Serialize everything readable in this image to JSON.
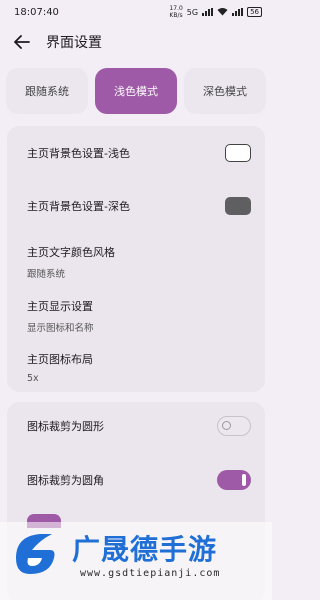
{
  "status_bar": {
    "time": "18:07:40",
    "net_speed_top": "17.0",
    "net_speed_unit": "KB/s",
    "network": "5G",
    "battery": "56"
  },
  "app_bar": {
    "title": "界面设置",
    "back_icon": "arrow-left-icon"
  },
  "theme_tabs": [
    {
      "label": "跟随系统",
      "active": false
    },
    {
      "label": "浅色模式",
      "active": true
    },
    {
      "label": "深色模式",
      "active": false
    }
  ],
  "colors": {
    "accent": "#9e5aa6",
    "light_swatch": "#ffffff",
    "dark_swatch": "#5f5f61"
  },
  "card_1": {
    "bg_light_label": "主页背景色设置-浅色",
    "bg_dark_label": "主页背景色设置-深色",
    "text_color_label": "主页文字颜色风格",
    "text_color_value": "跟随系统",
    "display_label": "主页显示设置",
    "display_value": "显示图标和名称",
    "layout_label": "主页图标布局",
    "layout_value": "5x"
  },
  "card_2": {
    "crop_circle_label": "图标裁剪为圆形",
    "crop_circle_on": false,
    "crop_rounded_label": "图标裁剪为圆角",
    "crop_rounded_on": true
  },
  "watermark": {
    "brand": "广晟德手游",
    "url": "www.gsdtiepianji.com"
  }
}
